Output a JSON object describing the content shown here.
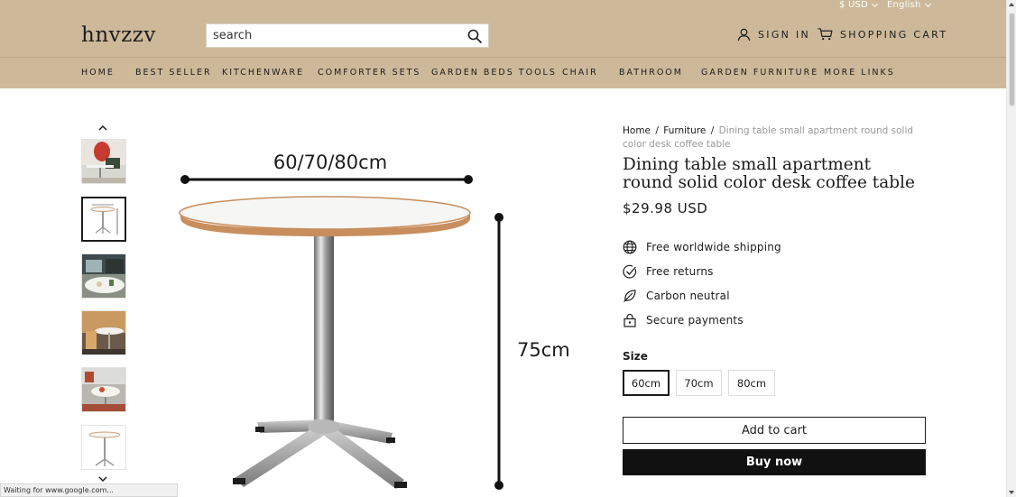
{
  "header": {
    "currency": "$ USD",
    "language": "English",
    "logo": "hnvzzv",
    "search_placeholder": "search",
    "sign_in": "SIGN IN",
    "cart": "SHOPPING CART",
    "background_color": "#cdb99a"
  },
  "nav": {
    "items": [
      {
        "label": "HOME"
      },
      {
        "label": "BEST SELLER"
      },
      {
        "label": "KITCHENWARE"
      },
      {
        "label": "COMFORTER SETS"
      },
      {
        "label": "GARDEN BEDS TOOLS"
      },
      {
        "label": "CHAIR"
      },
      {
        "label": "BATHROOM"
      },
      {
        "label": "GARDEN FURNITURE"
      },
      {
        "label": "MORE LINKS"
      }
    ]
  },
  "gallery": {
    "selected_index": 1,
    "image_labels": {
      "width": "60/70/80cm",
      "height": "75cm"
    }
  },
  "product": {
    "breadcrumb": [
      {
        "label": "Home"
      },
      {
        "label": "Furniture"
      },
      {
        "label": "Dining table small apartment round solid color desk coffee table"
      }
    ],
    "title": "Dining table small apartment round solid color desk coffee table",
    "price": "$29.98 USD",
    "features": [
      {
        "label": "Free worldwide shipping",
        "icon": "globe-icon"
      },
      {
        "label": "Free returns",
        "icon": "check-circle-icon"
      },
      {
        "label": "Carbon neutral",
        "icon": "leaf-icon"
      },
      {
        "label": "Secure payments",
        "icon": "lock-icon"
      }
    ],
    "size_label": "Size",
    "sizes": [
      {
        "label": "60cm"
      },
      {
        "label": "70cm"
      },
      {
        "label": "80cm"
      }
    ],
    "selected_size": "60cm",
    "add_to_cart": "Add to cart",
    "buy_now": "Buy now"
  },
  "status_bar": {
    "text": "Waiting for www.google.com..."
  }
}
